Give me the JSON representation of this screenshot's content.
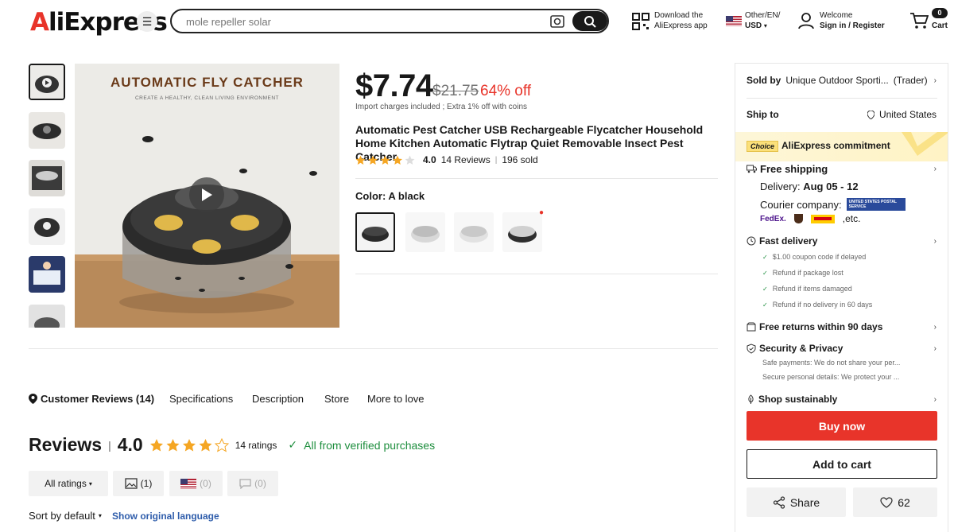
{
  "header": {
    "logo": "AliExpress",
    "search_placeholder": "mole repeller solar",
    "download_line1": "Download the",
    "download_line2": "AliExpress app",
    "locale_line1": "Other/EN/",
    "locale_line2": "USD",
    "welcome": "Welcome",
    "signin": "Sign in / Register",
    "cart_count": "0",
    "cart_label": "Cart"
  },
  "product": {
    "price": "$7.74",
    "original_price": "$21.75",
    "discount": "64% off",
    "price_note": "Import charges included ; Extra 1% off with coins",
    "title": "Automatic Pest Catcher USB Rechargeable Flycatcher Household Home Kitchen Automatic Flytrap Quiet Removable Insect Pest Catcher",
    "rating": "4.0",
    "rating_value": 4.0,
    "reviews": "14 Reviews",
    "sold": "196 sold",
    "color_label": "Color: A black",
    "image_banner_title": "AUTOMATIC FLY CATCHER",
    "image_banner_sub": "CREATE A HEALTHY, CLEAN LIVING ENVIRONMENT"
  },
  "panel": {
    "sold_by_label": "Sold by",
    "seller": "Unique Outdoor Sporti...",
    "seller_type": "(Trader)",
    "ship_to_label": "Ship to",
    "ship_to": "United States",
    "choice_badge": "Choice",
    "commitment": "AliExpress commitment",
    "free_shipping": "Free shipping",
    "delivery_label": "Delivery:",
    "delivery_dates": "Aug 05 - 12",
    "courier_label": "Courier company:",
    "courier_usps": "UNITED STATES POSTAL SERVICE",
    "courier_fedex": "FedEx.",
    "courier_etc": ",etc.",
    "fast_delivery": "Fast delivery",
    "fast_items": [
      "$1.00 coupon code if delayed",
      "Refund if package lost",
      "Refund if items damaged",
      "Refund if no delivery in 60 days"
    ],
    "free_returns": "Free returns within 90 days",
    "security": "Security & Privacy",
    "security_items": [
      "Safe payments: We do not share your per...",
      "Secure personal details: We protect your ..."
    ],
    "sustainably": "Shop sustainably",
    "buy_now": "Buy now",
    "add_to_cart": "Add to cart",
    "share": "Share",
    "wish_count": "62",
    "accent": "#e8342a"
  },
  "tabs": [
    "Customer Reviews (14)",
    "Specifications",
    "Description",
    "Store",
    "More to love"
  ],
  "reviews": {
    "heading": "Reviews",
    "score": "4.0",
    "ratings": "14 ratings",
    "verified": "All from verified purchases",
    "filter_all": "All ratings",
    "filter_photo": "(1)",
    "filter_us": "(0)",
    "filter_comment": "(0)",
    "sort": "Sort by default",
    "show_original": "Show original language"
  }
}
